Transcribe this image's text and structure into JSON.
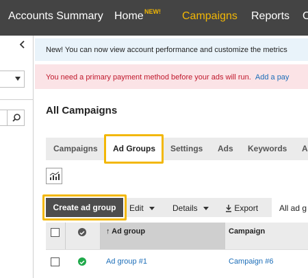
{
  "nav": {
    "items": [
      "Accounts Summary",
      "Home",
      "Campaigns",
      "Reports"
    ],
    "home_badge": "NEW!",
    "active": "Campaigns"
  },
  "banners": {
    "info": "New! You can now view account performance and customize the metrics",
    "warning": "You need a primary payment method before your ads will run.",
    "warning_link": "Add a pay"
  },
  "page_title": "All Campaigns",
  "tabs": [
    "Campaigns",
    "Ad Groups",
    "Settings",
    "Ads",
    "Keywords",
    "A"
  ],
  "active_tab": "Ad Groups",
  "toolbar": {
    "create": "Create ad group",
    "edit": "Edit",
    "details": "Details",
    "export": "Export",
    "filter": "All ad g"
  },
  "table": {
    "columns": [
      "Ad group",
      "Campaign"
    ],
    "sorted_column": "Ad group",
    "rows": [
      {
        "ad_group": "Ad group #1",
        "campaign": "Campaign #6",
        "status": "enabled"
      }
    ]
  },
  "colors": {
    "nav_bg": "#444444",
    "accent": "#f2b705",
    "link": "#1b6db8",
    "warning_text": "#c0182c",
    "status_enabled": "#1fa94a"
  }
}
